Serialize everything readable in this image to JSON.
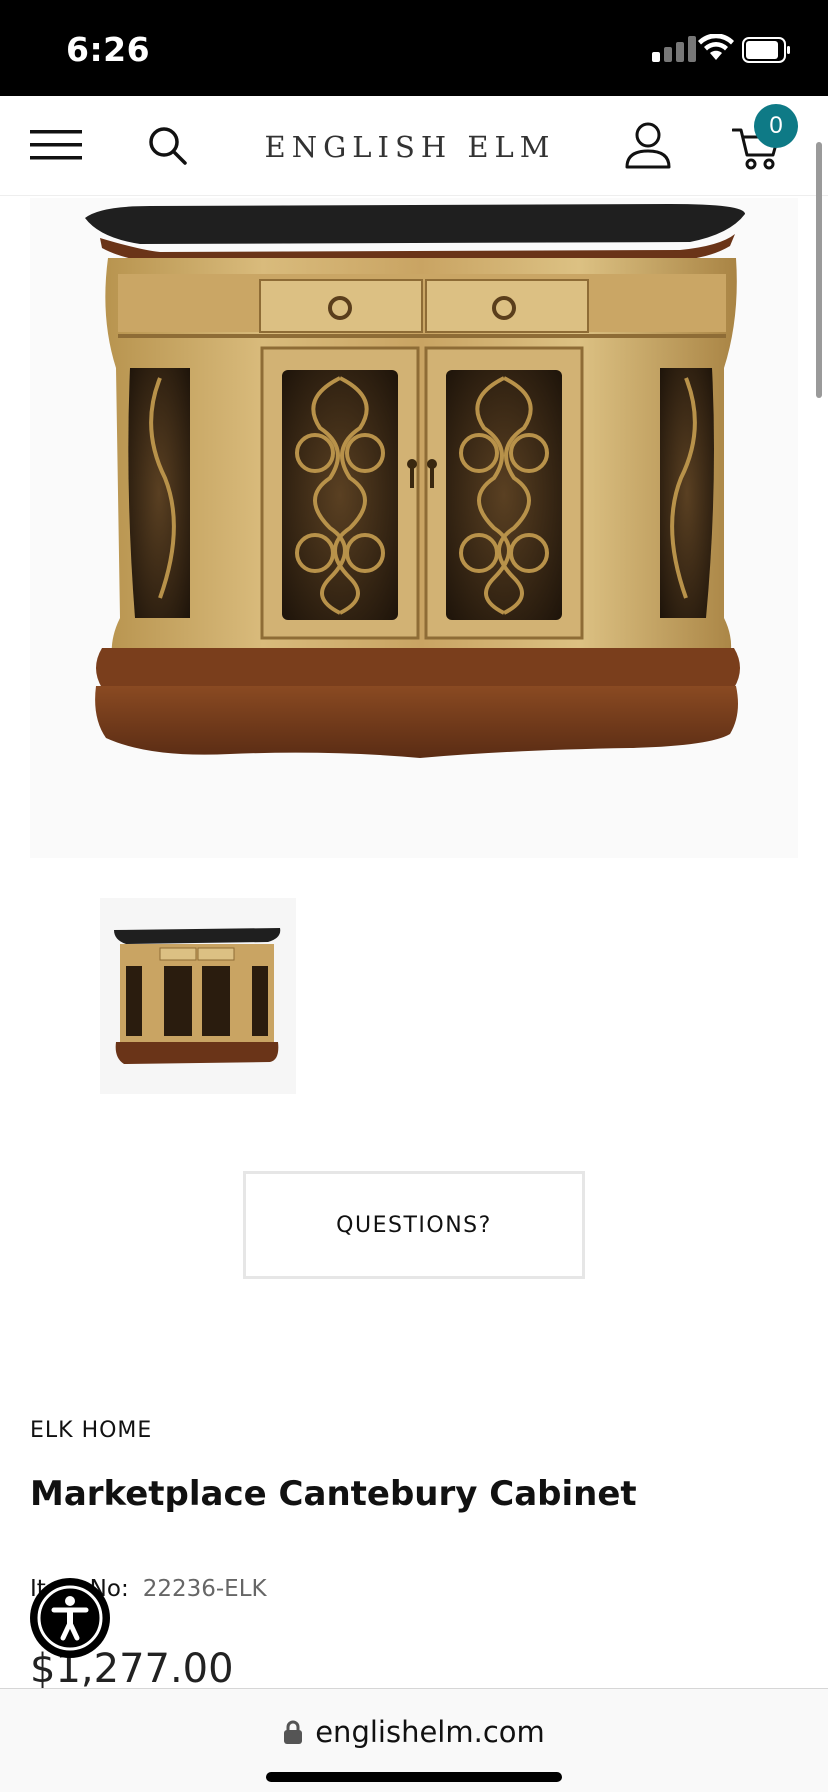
{
  "status_bar": {
    "time": "6:26"
  },
  "header": {
    "brand": "ENGLISH ELM",
    "cart_count": "0",
    "accent_color": "#0e7a86"
  },
  "product": {
    "questions_label": "QUESTIONS?",
    "brand": "ELK HOME",
    "title": "Marketplace Cantebury Cabinet",
    "item_label": "Item No:",
    "item_number": "22236-ELK",
    "price": "$1,277.00"
  },
  "browser": {
    "url": "englishelm.com"
  },
  "icons": [
    "menu-icon",
    "search-icon",
    "account-icon",
    "cart-icon",
    "lock-icon",
    "accessibility-icon"
  ]
}
